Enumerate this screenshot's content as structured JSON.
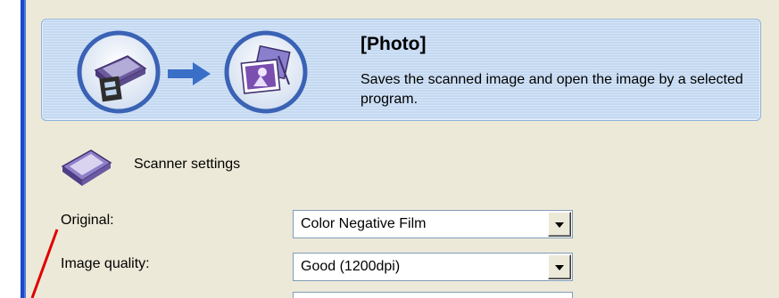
{
  "banner": {
    "title": "[Photo]",
    "description": "Saves the scanned image and open the image by a selected program.",
    "source_icon": "scanner-film-icon",
    "flow_icon": "arrow-right-icon",
    "target_icon": "photo-icon"
  },
  "scanner_settings": {
    "title": "Scanner settings",
    "icon": "scanner-icon",
    "original": {
      "label": "Original:",
      "value": "Color Negative Film"
    },
    "image_quality": {
      "label": "Image quality:",
      "value": "Good (1200dpi)"
    }
  },
  "colors": {
    "window_edge": "#1c49c9",
    "dialog_background": "#ede9d8",
    "banner_background": "#c8dcf3",
    "annotation_line": "#e00000"
  }
}
